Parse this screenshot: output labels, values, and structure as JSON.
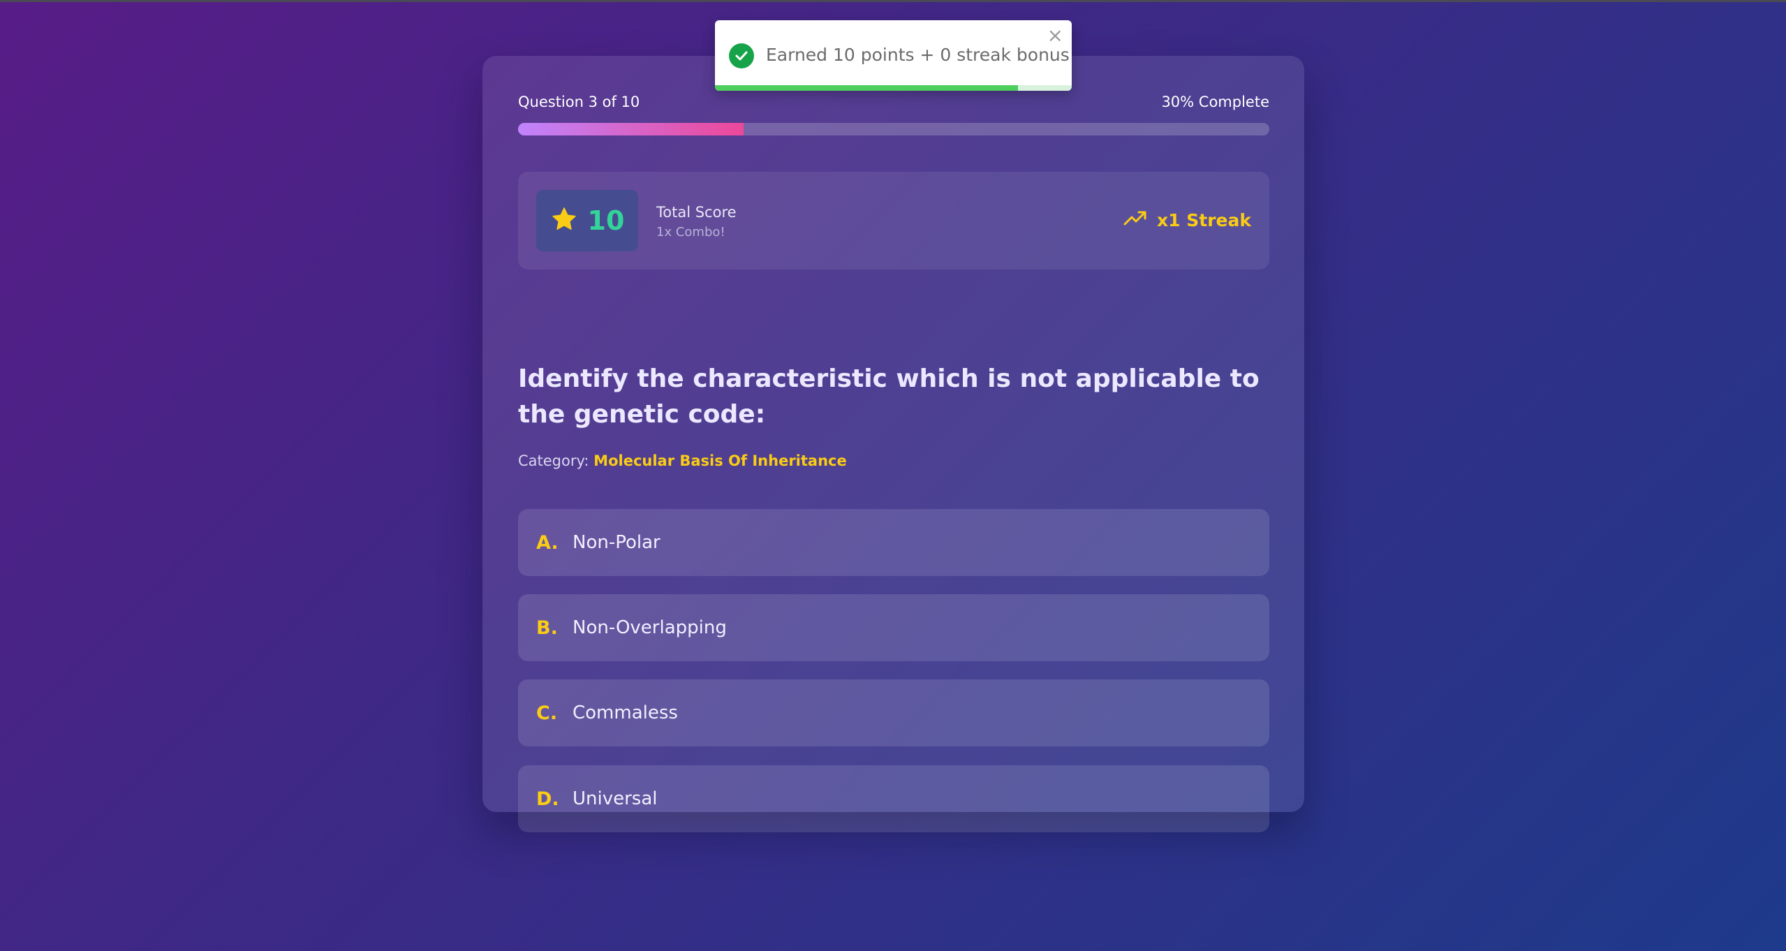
{
  "toast": {
    "message": "Earned 10 points + 0 streak bonus!",
    "close_glyph": "×",
    "timer_fraction": 0.85,
    "accent_color": "#16a34a"
  },
  "progress": {
    "question_label": "Question 3 of 10",
    "complete_label": "30% Complete",
    "fraction": 0.3
  },
  "score": {
    "icon": "star-icon",
    "value": "10",
    "title": "Total Score",
    "combo": "1x Combo!",
    "streak_icon": "trending-up-icon",
    "streak_label": "x1 Streak"
  },
  "question": {
    "text": "Identify the characteristic which is not applicable to the genetic code:",
    "category_label": "Category:",
    "category_name": "Molecular Basis Of Inheritance"
  },
  "options": [
    {
      "letter": "A.",
      "text": "Non-Polar"
    },
    {
      "letter": "B.",
      "text": "Non-Overlapping"
    },
    {
      "letter": "C.",
      "text": "Commaless"
    },
    {
      "letter": "D.",
      "text": "Universal"
    }
  ],
  "colors": {
    "accent_yellow": "#facc15",
    "score_green": "#34d399",
    "progress_start": "#c084fc",
    "progress_end": "#ec4899"
  }
}
